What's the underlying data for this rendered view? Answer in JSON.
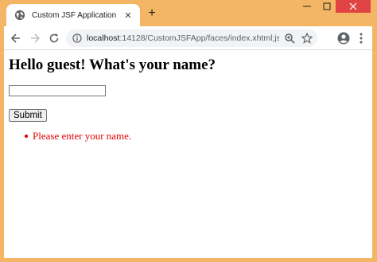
{
  "browser": {
    "tab": {
      "title": "Custom JSF Application",
      "favicon": "globe-icon",
      "close_glyph": "✕"
    },
    "new_tab_glyph": "+",
    "omnibox": {
      "host": "localhost",
      "path": ":14128/CustomJSFApp/faces/index.xhtml;jsessionid..."
    },
    "icons": [
      "back-icon",
      "forward-icon",
      "reload-icon",
      "info-icon",
      "zoom-icon",
      "star-icon",
      "account-icon",
      "menu-icon"
    ],
    "frame_color": "#f4b565",
    "close_button_color": "#e04343"
  },
  "page": {
    "heading": "Hello guest! What's your name?",
    "name_input": {
      "value": "",
      "placeholder": ""
    },
    "submit_label": "Submit",
    "messages": [
      "Please enter your name."
    ],
    "message_color": "#e00000"
  }
}
